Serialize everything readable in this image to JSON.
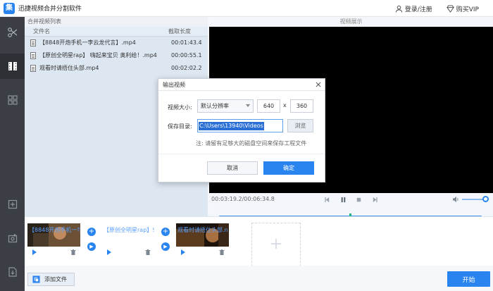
{
  "app": {
    "logo_char": "集",
    "title": "迅捷视频合并分割软件"
  },
  "topbar": {
    "login_label": "登录/注册",
    "vip_label": "购买VIP"
  },
  "sidebar": {
    "items": [
      {
        "icon": "scissors-icon"
      },
      {
        "icon": "film-merge-icon",
        "active": true
      },
      {
        "icon": "grid-icon"
      },
      {
        "icon": "import-icon"
      },
      {
        "icon": "settings-icon"
      },
      {
        "icon": "export-icon"
      }
    ]
  },
  "file_list": {
    "header": "合并视频列表",
    "col_name": "文件名",
    "col_duration": "截取长度",
    "rows": [
      {
        "name": "【8848开炮手机一李云龙代言】.mp4",
        "duration": "00:01:43.4"
      },
      {
        "name": "【原创全明星rap】 嗨起来宝贝 奥利给！.mp4",
        "duration": "00:00:55.1"
      },
      {
        "name": "观看时请捂住头部.mp4",
        "duration": "00:02:02.2"
      }
    ]
  },
  "preview": {
    "header": "视频展示",
    "time": "00:03:19.2/00:06:34.8",
    "progress": 0.5,
    "volume": 0.85
  },
  "clips": [
    {
      "name": "【8848开炮手机一李"
    },
    {
      "name": "【原创全明星rap】!"
    },
    {
      "name": "观看时请捂住头部.n"
    }
  ],
  "bottom": {
    "add_file_label": "添加文件",
    "start_label": "开始"
  },
  "dialog": {
    "title": "输出视频",
    "size_label": "视频大小:",
    "resolution_value": "默认分辨率",
    "width_value": "640",
    "x_sep": "x",
    "height_value": "360",
    "dir_label": "保存目录:",
    "dir_value": "C:\\Users\\13940\\Videos",
    "browse_label": "浏览",
    "note": "注:   请留有足够大的磁盘空间来保存工程文件",
    "cancel_label": "取消",
    "ok_label": "确定"
  },
  "colors": {
    "accent": "#2a84f0",
    "playhead": "#1cb580",
    "sidebar_bg": "#3b3f45"
  }
}
